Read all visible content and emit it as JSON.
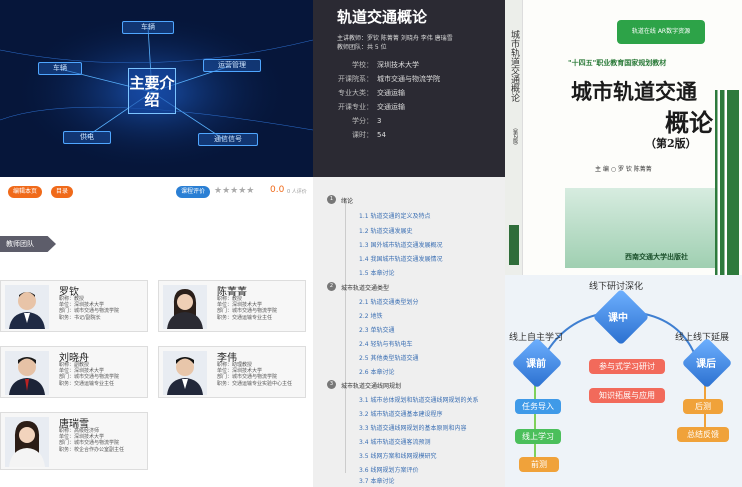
{
  "hero": {
    "center_title": "主要介绍",
    "nodes": [
      "车辆",
      "运营管理",
      "车辆",
      "供电",
      "通信信号"
    ]
  },
  "course": {
    "title": "轨道交通概论",
    "teachers_line": "主讲教师：罗钦 陈菁菁 刘晓舟 李伟 唐瑞雪",
    "team_line": "教师团队：共 5 位",
    "rows": [
      {
        "k": "学校：",
        "v": "深圳技术大学"
      },
      {
        "k": "开课院系：",
        "v": "城市交通与物流学院"
      },
      {
        "k": "专业大类：",
        "v": "交通运输"
      },
      {
        "k": "开课专业：",
        "v": "交通运输"
      },
      {
        "k": "学分：",
        "v": "3"
      },
      {
        "k": "课时：",
        "v": "54"
      }
    ]
  },
  "book": {
    "series_badge": "轨道在线 AR数字资源",
    "series_line": "\"十四五\"职业教育国家规划教材",
    "title_line1": "城市轨道交通",
    "title_line2": "概论",
    "edition": "（第2版）",
    "spine_title": "城市轨道交通概论",
    "spine_edition": "（第2版）",
    "authors": "主 编 ○ 罗 钦  陈菁菁",
    "publisher": "西南交通大学出版社"
  },
  "actions": {
    "edit_label": "编辑本页",
    "menu_label": "目录",
    "review_label": "课程评价",
    "stars": "★★★★★",
    "score": "0.0",
    "review_count": "0 人评价"
  },
  "team": {
    "tag": "教师团队",
    "teachers": [
      {
        "name": "罗钦",
        "lines": [
          "职称：教授",
          "单位：深圳技术大学",
          "部门：城市交通与物流学院",
          "职务：书记/副院长"
        ]
      },
      {
        "name": "陈菁菁",
        "lines": [
          "职称：教授",
          "单位：深圳技术大学",
          "部门：城市交通与物流学院",
          "职务：交通运输专业主任"
        ]
      },
      {
        "name": "刘晓舟",
        "lines": [
          "职称：副教授",
          "单位：深圳技术大学",
          "部门：城市交通与物流学院",
          "职务：交通运输专业主任"
        ]
      },
      {
        "name": "李伟",
        "lines": [
          "职称：助理教授",
          "单位：深圳技术大学",
          "部门：城市交通与物流学院",
          "职务：交通运输专业实验中心主任"
        ]
      },
      {
        "name": "唐瑞雪",
        "lines": [
          "职称：高级经济师",
          "单位：深圳技术大学",
          "部门：城市交通与物流学院",
          "职务：校企合作办公室副主任"
        ]
      }
    ]
  },
  "toc": {
    "chapters": [
      {
        "num": "1",
        "title": "绪论",
        "subs": [
          "1.1 轨道交通的定义及特点",
          "1.2 轨道交通发展史",
          "1.3 国外城市轨道交通发展概况",
          "1.4 我国城市轨道交通发展情况",
          "1.5 本章讨论"
        ]
      },
      {
        "num": "2",
        "title": "城市轨道交通类型",
        "subs": [
          "2.1 轨道交通类型划分",
          "2.2 地铁",
          "2.3 单轨交通",
          "2.4 轻轨与有轨电车",
          "2.5 其他类型轨道交通",
          "2.6 本章讨论"
        ]
      },
      {
        "num": "3",
        "title": "城市轨道交通线网规划",
        "subs": [
          "3.1 城市总体规划和轨道交通线网规划的关系",
          "3.2 城市轨道交通基本建设程序",
          "3.3 轨道交通线网规划的基本原则和内容",
          "3.4 城市轨道交通客流预测",
          "3.5 线网方案和线网规模研究",
          "3.6 线网规划方案评价",
          "3.7 本章讨论"
        ]
      }
    ]
  },
  "mindmap": {
    "top_label": "线下研讨深化",
    "left_label": "线上自主学习",
    "right_label": "线上线下延展",
    "center": "课中",
    "left": "课前",
    "right": "课后",
    "mid_boxes": [
      "参与式学习研讨",
      "知识拓展与应用"
    ],
    "left_boxes": [
      "任务导入",
      "线上学习",
      "前测"
    ],
    "right_boxes": [
      "后测",
      "总结反馈"
    ]
  }
}
